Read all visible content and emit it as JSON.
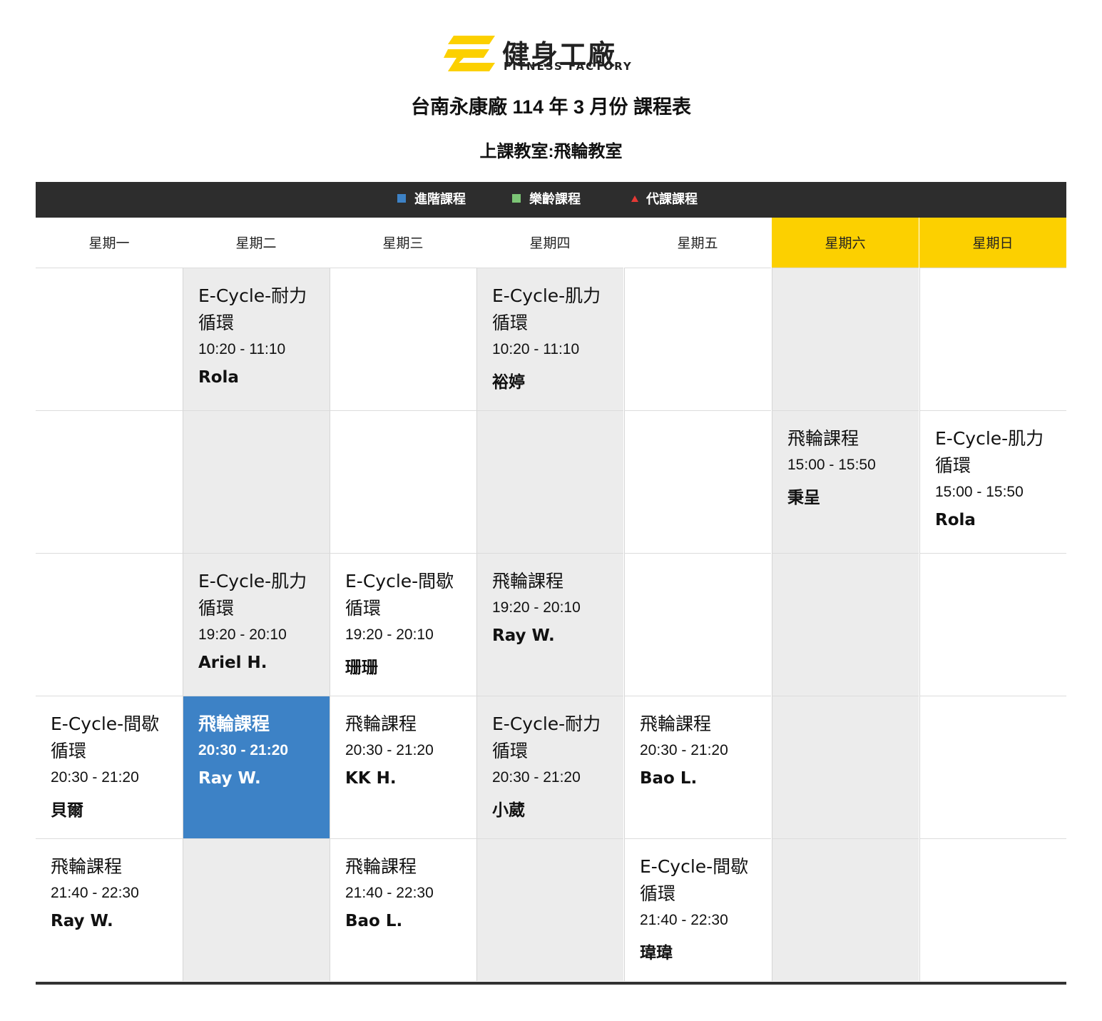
{
  "logo": {
    "brand_cn": "健身工廠",
    "brand_en": "FITNESS FACTORY",
    "accent": "#fcd000"
  },
  "title": "台南永康廠 114 年 3 月份 課程表",
  "subtitle": "上課教室:飛輪教室",
  "legend": [
    {
      "label": "進階課程",
      "color": "#3d82c6",
      "shape": "square"
    },
    {
      "label": "樂齡課程",
      "color": "#7cc576",
      "shape": "square"
    },
    {
      "label": "代課課程",
      "color": "#e53935",
      "shape": "triangle"
    }
  ],
  "days": [
    "星期一",
    "星期二",
    "星期三",
    "星期四",
    "星期五",
    "星期六",
    "星期日"
  ],
  "weekend_color": "#fcd000",
  "schedule": {
    "r0": {
      "tue": {
        "name": "E-Cycle-耐力循環",
        "time": "10:20 - 11:10",
        "teacher": "Rola"
      },
      "thu": {
        "name": "E-Cycle-肌力循環",
        "time": "10:20 - 11:10",
        "teacher": "裕婷"
      }
    },
    "r1": {
      "sat": {
        "name": "飛輪課程",
        "time": "15:00 - 15:50",
        "teacher": "秉呈"
      },
      "sun": {
        "name": "E-Cycle-肌力循環",
        "time": "15:00 - 15:50",
        "teacher": "Rola"
      }
    },
    "r2": {
      "tue": {
        "name": "E-Cycle-肌力循環",
        "time": "19:20 - 20:10",
        "teacher": "Ariel H."
      },
      "wed": {
        "name": "E-Cycle-間歇循環",
        "time": "19:20 - 20:10",
        "teacher": "珊珊"
      },
      "thu": {
        "name": "飛輪課程",
        "time": "19:20 - 20:10",
        "teacher": "Ray W."
      }
    },
    "r3": {
      "mon": {
        "name": "E-Cycle-間歇循環",
        "time": "20:30 - 21:20",
        "teacher": "貝爾"
      },
      "tue": {
        "name": "飛輪課程",
        "time": "20:30 - 21:20",
        "teacher": "Ray W.",
        "type": "進階課程"
      },
      "wed": {
        "name": "飛輪課程",
        "time": "20:30 - 21:20",
        "teacher": "KK H."
      },
      "thu": {
        "name": "E-Cycle-耐力循環",
        "time": "20:30 - 21:20",
        "teacher": "小葳"
      },
      "fri": {
        "name": "飛輪課程",
        "time": "20:30 - 21:20",
        "teacher": "Bao L."
      }
    },
    "r4": {
      "mon": {
        "name": "飛輪課程",
        "time": "21:40 - 22:30",
        "teacher": "Ray W."
      },
      "wed": {
        "name": "飛輪課程",
        "time": "21:40 - 22:30",
        "teacher": "Bao L."
      },
      "fri": {
        "name": "E-Cycle-間歇循環",
        "time": "21:40 - 22:30",
        "teacher": "瑋瑋"
      }
    }
  }
}
